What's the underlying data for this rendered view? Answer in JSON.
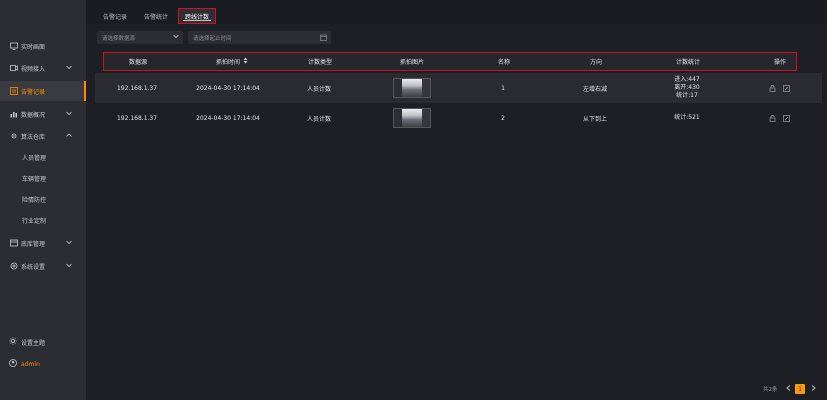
{
  "sidebar": {
    "items": [
      {
        "label": "实时画面",
        "icon": "monitor-icon"
      },
      {
        "label": "视频接入",
        "icon": "video-icon"
      },
      {
        "label": "告警记录",
        "icon": "alert-icon"
      },
      {
        "label": "数据概况",
        "icon": "chart-icon"
      },
      {
        "label": "算法仓库",
        "icon": "algorithm-icon"
      }
    ],
    "sub_items": [
      "人员管理",
      "车辆管理",
      "险情防控",
      "行业定制"
    ],
    "lower_items": [
      {
        "label": "底库管理",
        "icon": "database-icon"
      },
      {
        "label": "系统设置",
        "icon": "gear-icon"
      }
    ],
    "theme_label": "设置主题",
    "user_label": "admin"
  },
  "tabs": [
    "告警记录",
    "告警统计",
    "跨线计数"
  ],
  "filters": {
    "source_placeholder": "请选择数据源",
    "time_placeholder": "请选择起止时间"
  },
  "table": {
    "headers": [
      "数据源",
      "抓拍时间",
      "计数类型",
      "抓拍图片",
      "名称",
      "方向",
      "计数统计",
      "操作"
    ],
    "rows": [
      {
        "source": "192.168.1.37",
        "time": "2024-04-30 17:14:04",
        "type": "人员计数",
        "name": "1",
        "direction": "左增右减",
        "stats": [
          "进入:447",
          "离开:430",
          "统计:17"
        ]
      },
      {
        "source": "192.168.1.37",
        "time": "2024-04-30 17:14:04",
        "type": "人员计数",
        "name": "2",
        "direction": "从下到上",
        "stats": [
          "统计:521"
        ]
      }
    ]
  },
  "pager": {
    "total": "共2条",
    "current": "1"
  },
  "colors": {
    "accent": "#ff8a00",
    "highlight_border": "#d10f22",
    "sidebar_bg": "#2b2d33",
    "main_bg": "#1e1f24"
  }
}
